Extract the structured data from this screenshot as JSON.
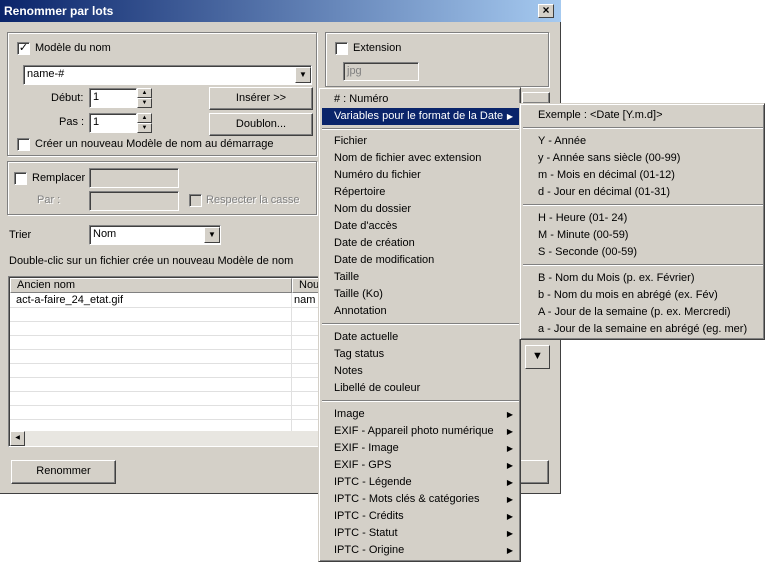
{
  "dialog": {
    "title": "Renommer par lots",
    "close_label": "×"
  },
  "name_model": {
    "checkbox_label": "Modèle du nom",
    "checked_mark": "✓",
    "value": "name-#",
    "debut_label": "Début:",
    "debut_value": "1",
    "pas_label": "Pas :",
    "pas_value": "1",
    "insert_button": "Insérer >>",
    "doublon_button": "Doublon...",
    "new_model_checkbox_label": "Créer un nouveau Modèle de nom au démarrage"
  },
  "extension": {
    "checkbox_label": "Extension",
    "value": "jpg"
  },
  "replace": {
    "checkbox_label": "Remplacer",
    "par_label": "Par :",
    "case_label": "Respecter la casse"
  },
  "sort": {
    "label": "Trier",
    "value": "Nom"
  },
  "hint": "Double-clic sur un fichier crée un nouveau Modèle de nom",
  "list": {
    "columns": [
      "Ancien nom",
      "Nou"
    ],
    "rows": [
      {
        "old": "act-a-faire_24_etat.gif",
        "new": "nam"
      }
    ]
  },
  "rename_button": "Renommer",
  "arrows": {
    "down": "▼",
    "up_small": "▲",
    "down_small": "▼",
    "left": "◀",
    "right": "▶"
  },
  "context_menu": {
    "group1": [
      "# : Numéro",
      "Variables pour le format de la Date"
    ],
    "group2": [
      "Fichier",
      "Nom de fichier avec extension",
      "Numéro du fichier",
      "Répertoire",
      "Nom du dossier",
      "Date d'accès",
      "Date de création",
      "Date de modification",
      "Taille",
      "Taille (Ko)",
      "Annotation"
    ],
    "group3": [
      "Date actuelle",
      "Tag status",
      "Notes",
      "Libellé de couleur"
    ],
    "group4": [
      "Image",
      "EXIF - Appareil photo numérique",
      "EXIF - Image",
      "EXIF - GPS",
      "IPTC - Légende",
      "IPTC - Mots clés & catégories",
      "IPTC - Crédits",
      "IPTC - Statut",
      "IPTC - Origine"
    ]
  },
  "date_submenu": {
    "example": "Exemple : <Date [Y.m.d]>",
    "group1": [
      "Y - Année",
      "y - Année sans siècle (00-99)",
      "m - Mois en décimal (01-12)",
      "d - Jour en décimal (01-31)"
    ],
    "group2": [
      "H - Heure (01- 24)",
      "M - Minute (00-59)",
      "S - Seconde (00-59)"
    ],
    "group3": [
      "B - Nom du Mois (p. ex. Février)",
      "b - Nom du mois en abrégé (ex. Fév)",
      "A - Jour de la semaine (p. ex. Mercredi)",
      "a - Jour de la semaine en abrégé (eg. mer)"
    ]
  },
  "colors": {
    "dialog_bg": "#d4d0c8",
    "titlebar": "#0a246a",
    "highlight": "#0a246a"
  }
}
